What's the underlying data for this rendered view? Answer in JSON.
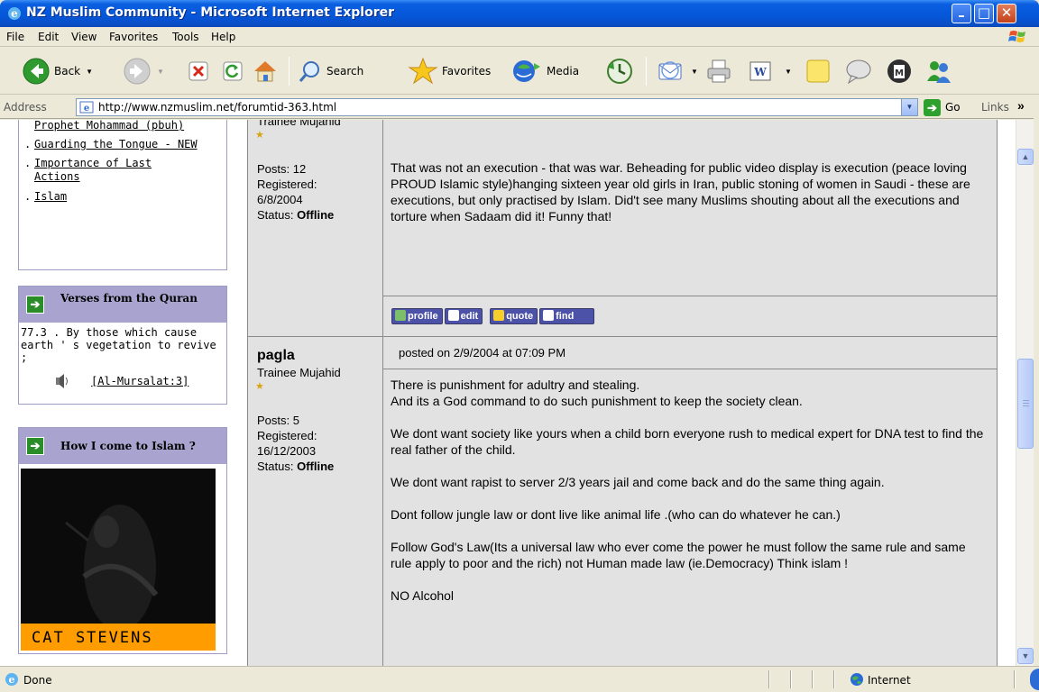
{
  "window": {
    "title": "NZ Muslim Community - Microsoft Internet Explorer",
    "buttons": {
      "minimize": "–",
      "maximize": "□",
      "close": "✕"
    }
  },
  "menu": [
    "File",
    "Edit",
    "View",
    "Favorites",
    "Tools",
    "Help"
  ],
  "toolbar": {
    "back": "Back",
    "search": "Search",
    "favorites": "Favorites",
    "media": "Media"
  },
  "address": {
    "label": "Address",
    "url": "http://www.nzmuslim.net/forumtid-363.html",
    "go": "Go",
    "links": "Links",
    "chevron": "»"
  },
  "sidebar": {
    "links": [
      {
        "bullet": "",
        "text": "Prophet Mohammad (pbuh)"
      },
      {
        "bullet": ".",
        "text": "Guarding the Tongue - NEW"
      },
      {
        "bullet": ".",
        "text": "Importance of Last Actions"
      },
      {
        "bullet": ".",
        "text": "Islam"
      }
    ],
    "verses": {
      "title": "Verses from the Quran",
      "text": "77.3 . By those which cause earth ' s vegetation to revive ;",
      "reference": "[Al-Mursalat:3]"
    },
    "islam_box": {
      "title": "How I come to Islam ?",
      "caption": "CAT STEVENS"
    }
  },
  "posts": [
    {
      "author": "",
      "rank": "Trainee Mujahid",
      "posts_label": "Posts: 12",
      "registered_label": "Registered:",
      "registered_date": "6/8/2004",
      "status_label": "Status: ",
      "status_value": "Offline",
      "body": "That was not an execution - that was war. Beheading for public video display is execution (peace loving PROUD Islamic style)hanging sixteen year old girls in Iran, public stoning of women in Saudi - these are executions, but only practised by Islam. Did't see many Muslims shouting about all the executions and torture when Sadaam did it! Funny that!",
      "buttons": [
        "profile",
        "edit",
        "quote",
        "find"
      ]
    },
    {
      "author": "pagla",
      "rank": "Trainee Mujahid",
      "posts_label": "Posts: 5",
      "registered_label": "Registered:",
      "registered_date": "16/12/2003",
      "status_label": "Status: ",
      "status_value": "Offline",
      "posted": "posted on 2/9/2004 at 07:09 PM",
      "paragraphs": [
        "There is punishment for adultry and stealing.",
        "And its a God command to do such punishment to keep the society clean.",
        "We dont want society like yours when a child born everyone rush to medical expert for DNA test to find the real father of the child.",
        "We dont want rapist to server 2/3 years jail and come back and do the same thing again.",
        "Dont follow jungle law or dont live like animal life .(who can do whatever he can.)",
        "Follow God's Law(Its a universal law who ever come the power he must follow the same rule and same rule apply to poor and the rich) not Human made law (ie.Democracy) Think islam !",
        "NO Alcohol"
      ]
    }
  ],
  "status": {
    "text": "Done",
    "zone": "Internet"
  },
  "colors": {
    "titlebar": "#0556d8",
    "sidebar_header": "#a9a4cf",
    "post_background": "#e2e2e2",
    "caption_bar": "#ff9d00"
  }
}
